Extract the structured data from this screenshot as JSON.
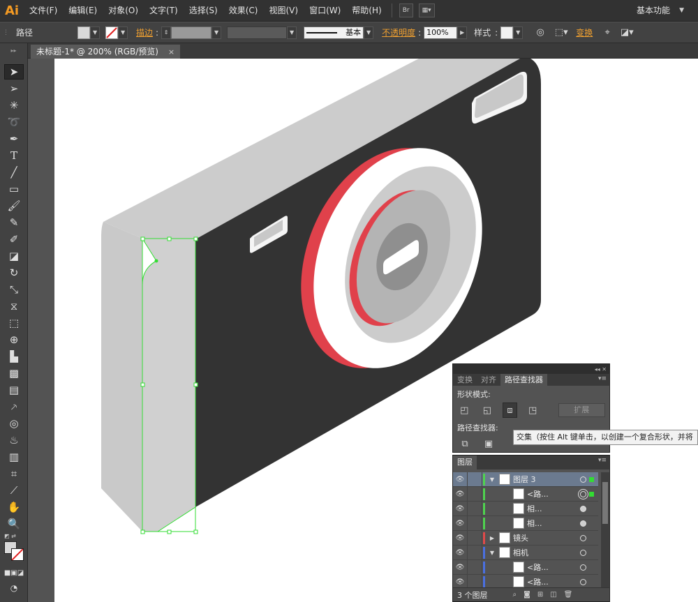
{
  "app": {
    "logo": "Ai",
    "workspace": "基本功能"
  },
  "menu": [
    "文件(F)",
    "编辑(E)",
    "对象(O)",
    "文字(T)",
    "选择(S)",
    "效果(C)",
    "视图(V)",
    "窗口(W)",
    "帮助(H)"
  ],
  "menu_buttons": {
    "bridge": "Br"
  },
  "control": {
    "selection_type": "路径",
    "stroke_label": "描边",
    "stroke_profile": "基本",
    "opacity_label": "不透明度",
    "opacity_value": "100%",
    "style_label": "样式",
    "transform_label": "变换"
  },
  "document": {
    "tab_title": "未标题-1* @ 200% (RGB/预览)",
    "close": "×"
  },
  "pathfinder": {
    "tabs": [
      "变换",
      "对齐",
      "路径查找器"
    ],
    "active_tab": "路径查找器",
    "shape_modes_label": "形状模式:",
    "pathfinders_label": "路径查找器:",
    "expand_label": "扩展"
  },
  "tooltip": "交集（按住 Alt 键单击，以创建一个复合形状，并将",
  "layers": {
    "tab": "图层",
    "rows": [
      {
        "name": "图层 3",
        "color": "#4fd24f",
        "twirl": "▼",
        "indent": 0,
        "selected": true
      },
      {
        "name": "<路...",
        "color": "#4fd24f",
        "twirl": "",
        "indent": 1,
        "selected": false
      },
      {
        "name": "相...",
        "color": "#4fd24f",
        "twirl": "",
        "indent": 1,
        "selected": false
      },
      {
        "name": "相...",
        "color": "#4fd24f",
        "twirl": "",
        "indent": 1,
        "selected": false
      },
      {
        "name": "镜头",
        "color": "#e04a4a",
        "twirl": "▶",
        "indent": 0,
        "selected": false
      },
      {
        "name": "相机",
        "color": "#4a6fe0",
        "twirl": "▼",
        "indent": 0,
        "selected": false
      },
      {
        "name": "<路...",
        "color": "#4a6fe0",
        "twirl": "",
        "indent": 1,
        "selected": false
      },
      {
        "name": "<路...",
        "color": "#4a6fe0",
        "twirl": "",
        "indent": 1,
        "selected": false
      }
    ],
    "footer": "3 个图层"
  },
  "colors": {
    "accent_orange": "#f59b23",
    "camera_body": "#333333",
    "camera_side": "#cccccc",
    "lens_red": "#e0414b",
    "selection": "#33dd33"
  }
}
